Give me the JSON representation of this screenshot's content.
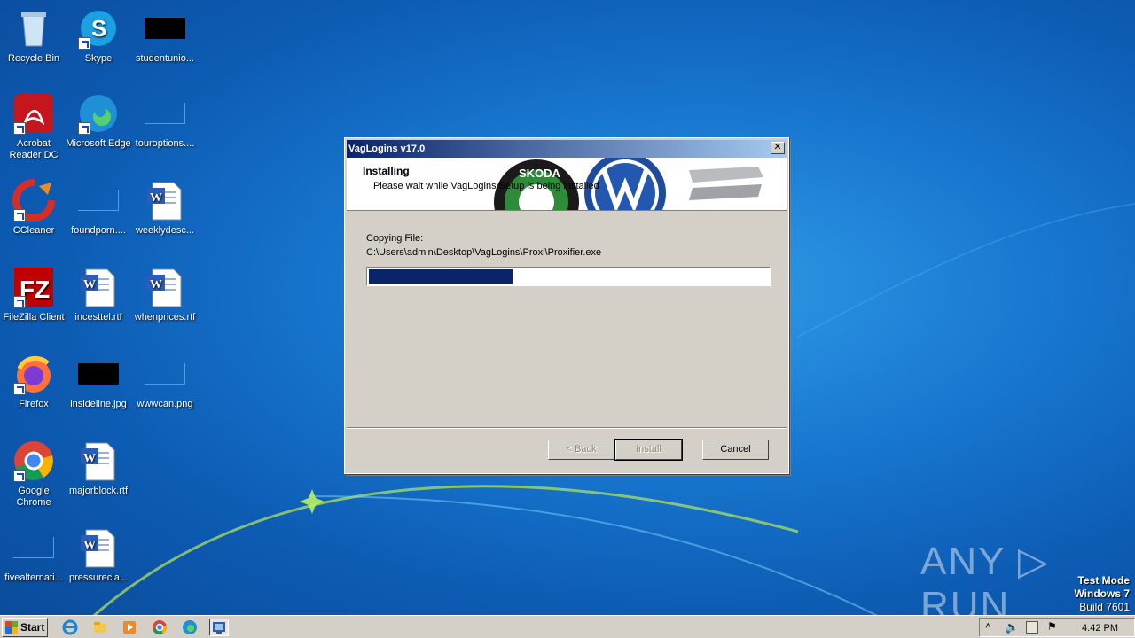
{
  "desktop": {
    "icons": [
      {
        "id": "recycle-bin",
        "label": "Recycle Bin"
      },
      {
        "id": "skype",
        "label": "Skype"
      },
      {
        "id": "studentunio",
        "label": "studentunio..."
      },
      {
        "id": "acrobat",
        "label": "Acrobat Reader DC"
      },
      {
        "id": "edge",
        "label": "Microsoft Edge"
      },
      {
        "id": "touroptions",
        "label": "touroptions...."
      },
      {
        "id": "ccleaner",
        "label": "CCleaner"
      },
      {
        "id": "foundporn",
        "label": "foundporn...."
      },
      {
        "id": "weeklydesc",
        "label": "weeklydesc..."
      },
      {
        "id": "filezilla",
        "label": "FileZilla Client"
      },
      {
        "id": "incesttel",
        "label": "incesttel.rtf"
      },
      {
        "id": "whenprices",
        "label": "whenprices.rtf"
      },
      {
        "id": "firefox",
        "label": "Firefox"
      },
      {
        "id": "insideline",
        "label": "insideline.jpg"
      },
      {
        "id": "wwwcan",
        "label": "wwwcan.png"
      },
      {
        "id": "chrome",
        "label": "Google Chrome"
      },
      {
        "id": "majorblock",
        "label": "majorblock.rtf"
      },
      {
        "id": "fivealternati",
        "label": "fivealternati..."
      },
      {
        "id": "pressurecla",
        "label": "pressurecla..."
      }
    ]
  },
  "dialog": {
    "title": "VagLogins v17.0",
    "close_glyph": "✕",
    "header_title": "Installing",
    "header_subtitle": "Please wait while VagLogins Setup is being installed",
    "copy_label": "Copying File:",
    "copy_path": "C:\\Users\\admin\\Desktop\\VagLogins\\Proxi\\Proxifier.exe",
    "progress_fraction": 0.36,
    "buttons": {
      "back": "< Back",
      "install": "Install",
      "cancel": "Cancel"
    }
  },
  "watermark": {
    "text": "ANY ▷ RUN"
  },
  "os_info": {
    "line1": "Test Mode",
    "line2": "Windows 7",
    "line3": "Build 7601"
  },
  "taskbar": {
    "start_label": "Start",
    "clock": "4:42 PM",
    "pinned": [
      "internet-explorer-icon",
      "file-explorer-icon",
      "media-player-icon",
      "chrome-icon",
      "edge-icon",
      "installer-task-icon"
    ]
  },
  "colors": {
    "accent": "#0a246a",
    "desktop": "#1877cf"
  }
}
